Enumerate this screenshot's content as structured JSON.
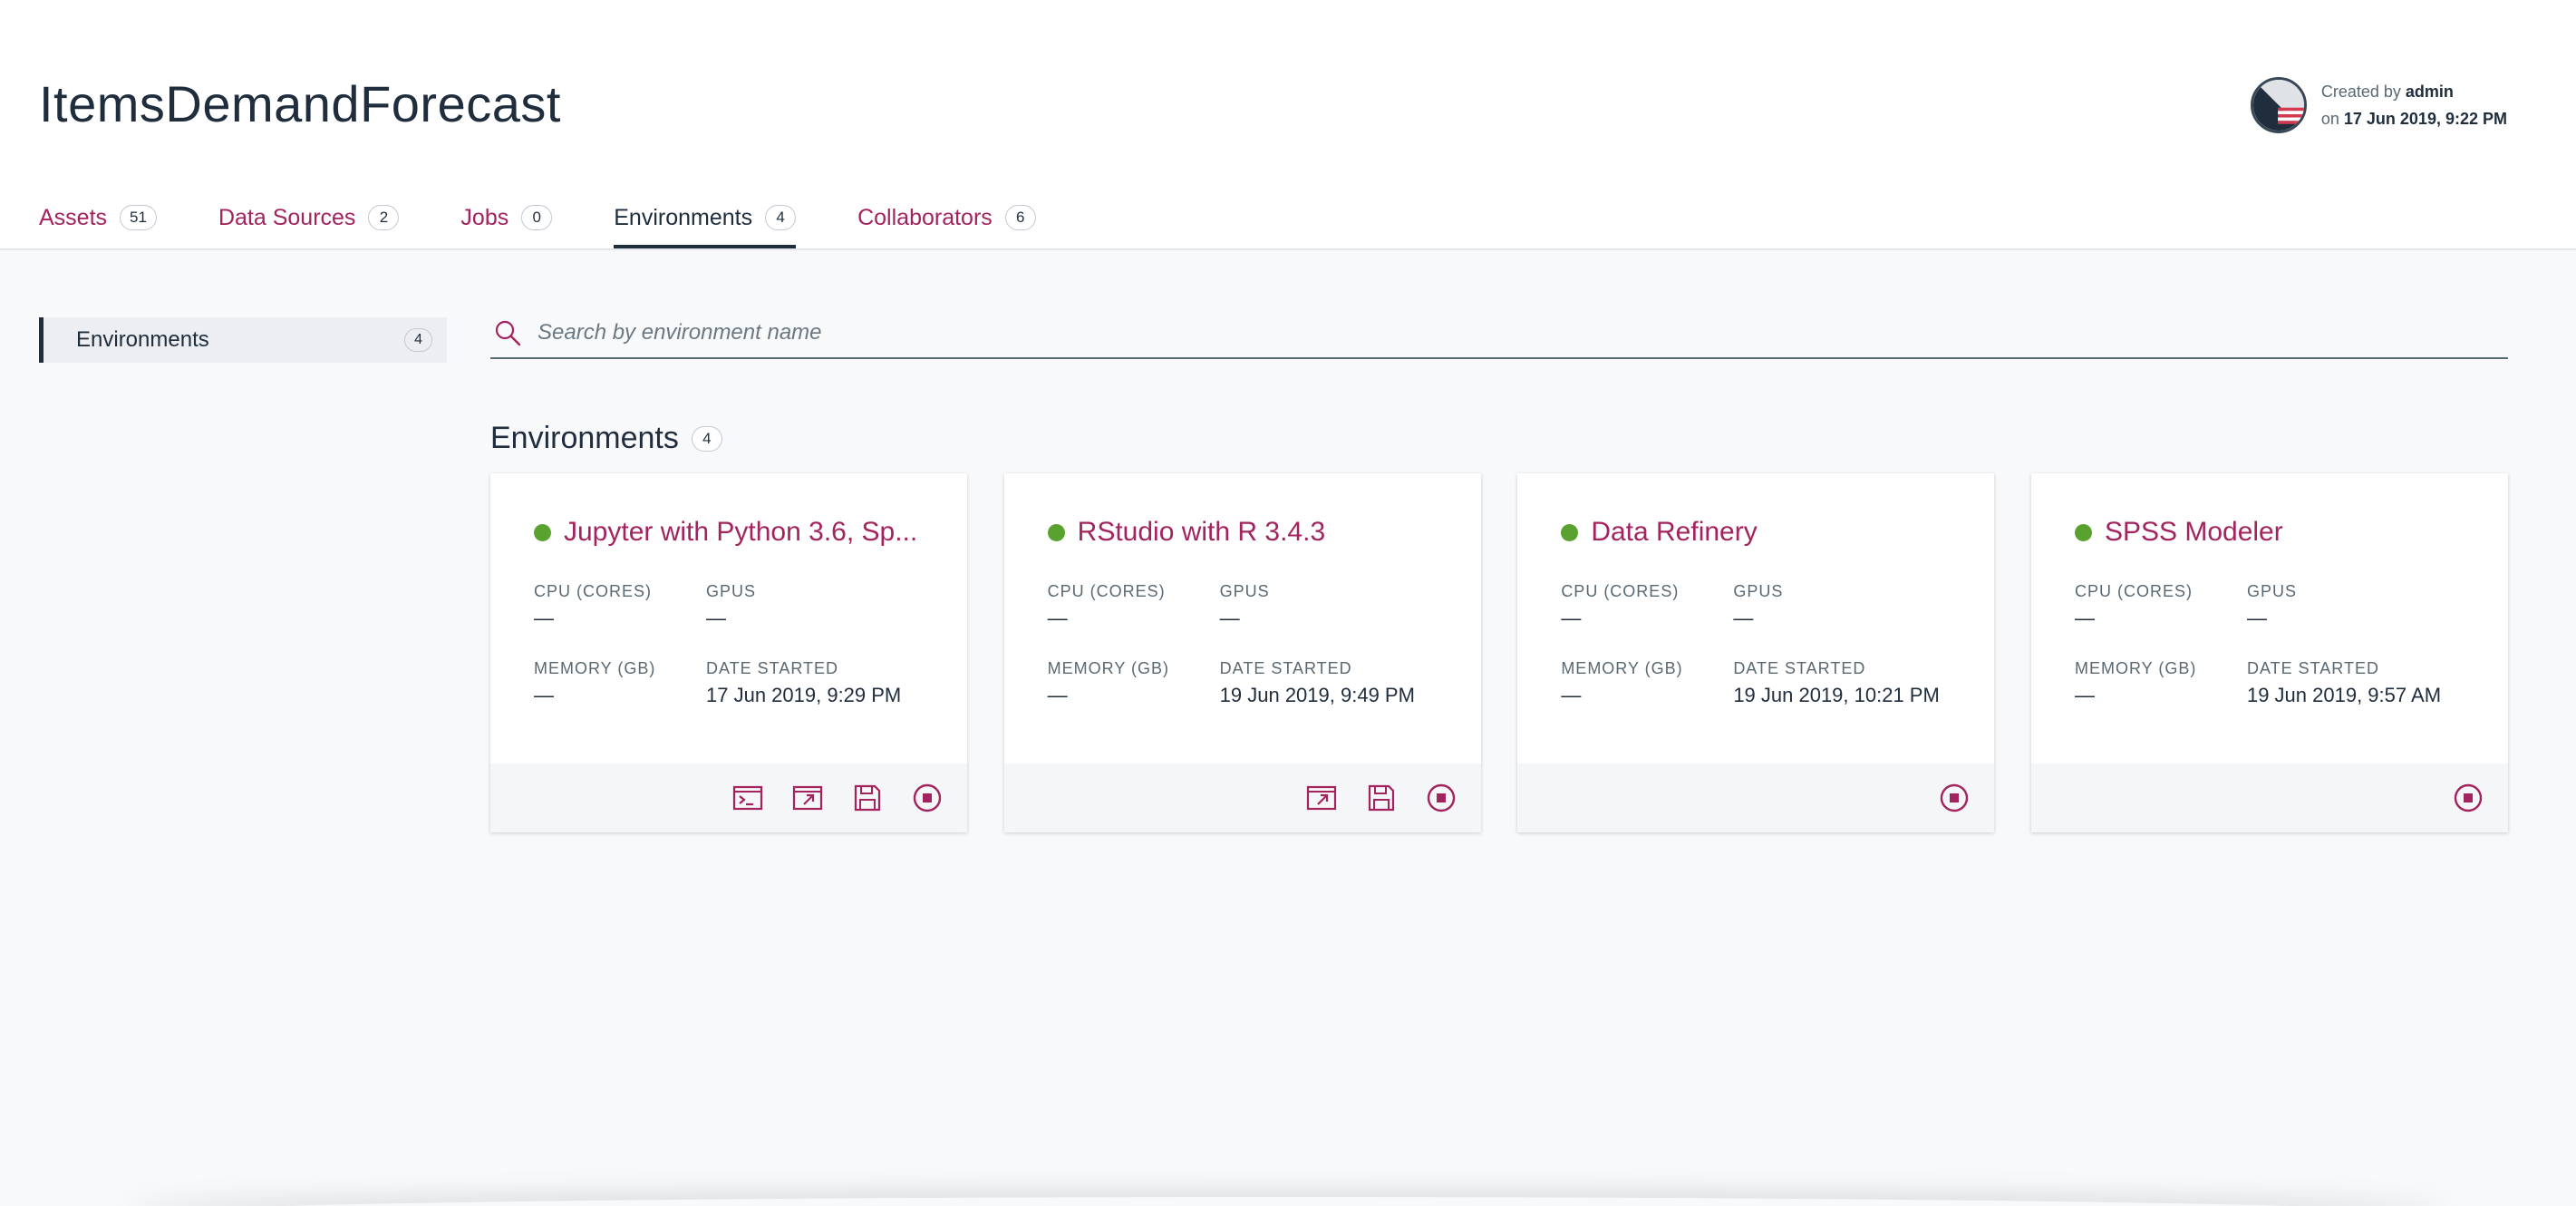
{
  "project": {
    "title": "ItemsDemandForecast",
    "created_by_label": "Created by",
    "created_by": "admin",
    "created_on_label": "on",
    "created_on": "17 Jun 2019, 9:22 PM"
  },
  "tabs": [
    {
      "label": "Assets",
      "count": "51"
    },
    {
      "label": "Data Sources",
      "count": "2"
    },
    {
      "label": "Jobs",
      "count": "0"
    },
    {
      "label": "Environments",
      "count": "4"
    },
    {
      "label": "Collaborators",
      "count": "6"
    }
  ],
  "sidebar": {
    "items": [
      {
        "label": "Environments",
        "count": "4"
      }
    ]
  },
  "search": {
    "placeholder": "Search by environment name"
  },
  "section": {
    "title": "Environments",
    "count": "4"
  },
  "labels": {
    "cpu": "CPU (CORES)",
    "gpus": "GPUS",
    "memory": "MEMORY (GB)",
    "date_started": "DATE STARTED"
  },
  "environments": [
    {
      "name": "Jupyter with Python 3.6, Sp...",
      "status": "running",
      "cpu": "—",
      "gpus": "—",
      "memory": "—",
      "date_started": "17 Jun 2019, 9:29 PM",
      "actions": [
        "terminal-icon",
        "open-external-icon",
        "save-icon",
        "stop-icon"
      ]
    },
    {
      "name": "RStudio with R 3.4.3",
      "status": "running",
      "cpu": "—",
      "gpus": "—",
      "memory": "—",
      "date_started": "19 Jun 2019, 9:49 PM",
      "actions": [
        "open-external-icon",
        "save-icon",
        "stop-icon"
      ]
    },
    {
      "name": "Data Refinery",
      "status": "running",
      "cpu": "—",
      "gpus": "—",
      "memory": "—",
      "date_started": "19 Jun 2019, 10:21 PM",
      "actions": [
        "stop-icon"
      ]
    },
    {
      "name": "SPSS Modeler",
      "status": "running",
      "cpu": "—",
      "gpus": "—",
      "memory": "—",
      "date_started": "19 Jun 2019, 9:57 AM",
      "actions": [
        "stop-icon"
      ]
    }
  ],
  "colors": {
    "accent": "#a3235f",
    "text": "#1f2d3d",
    "status_running": "#5aa230",
    "background": "#f8f9fb"
  }
}
